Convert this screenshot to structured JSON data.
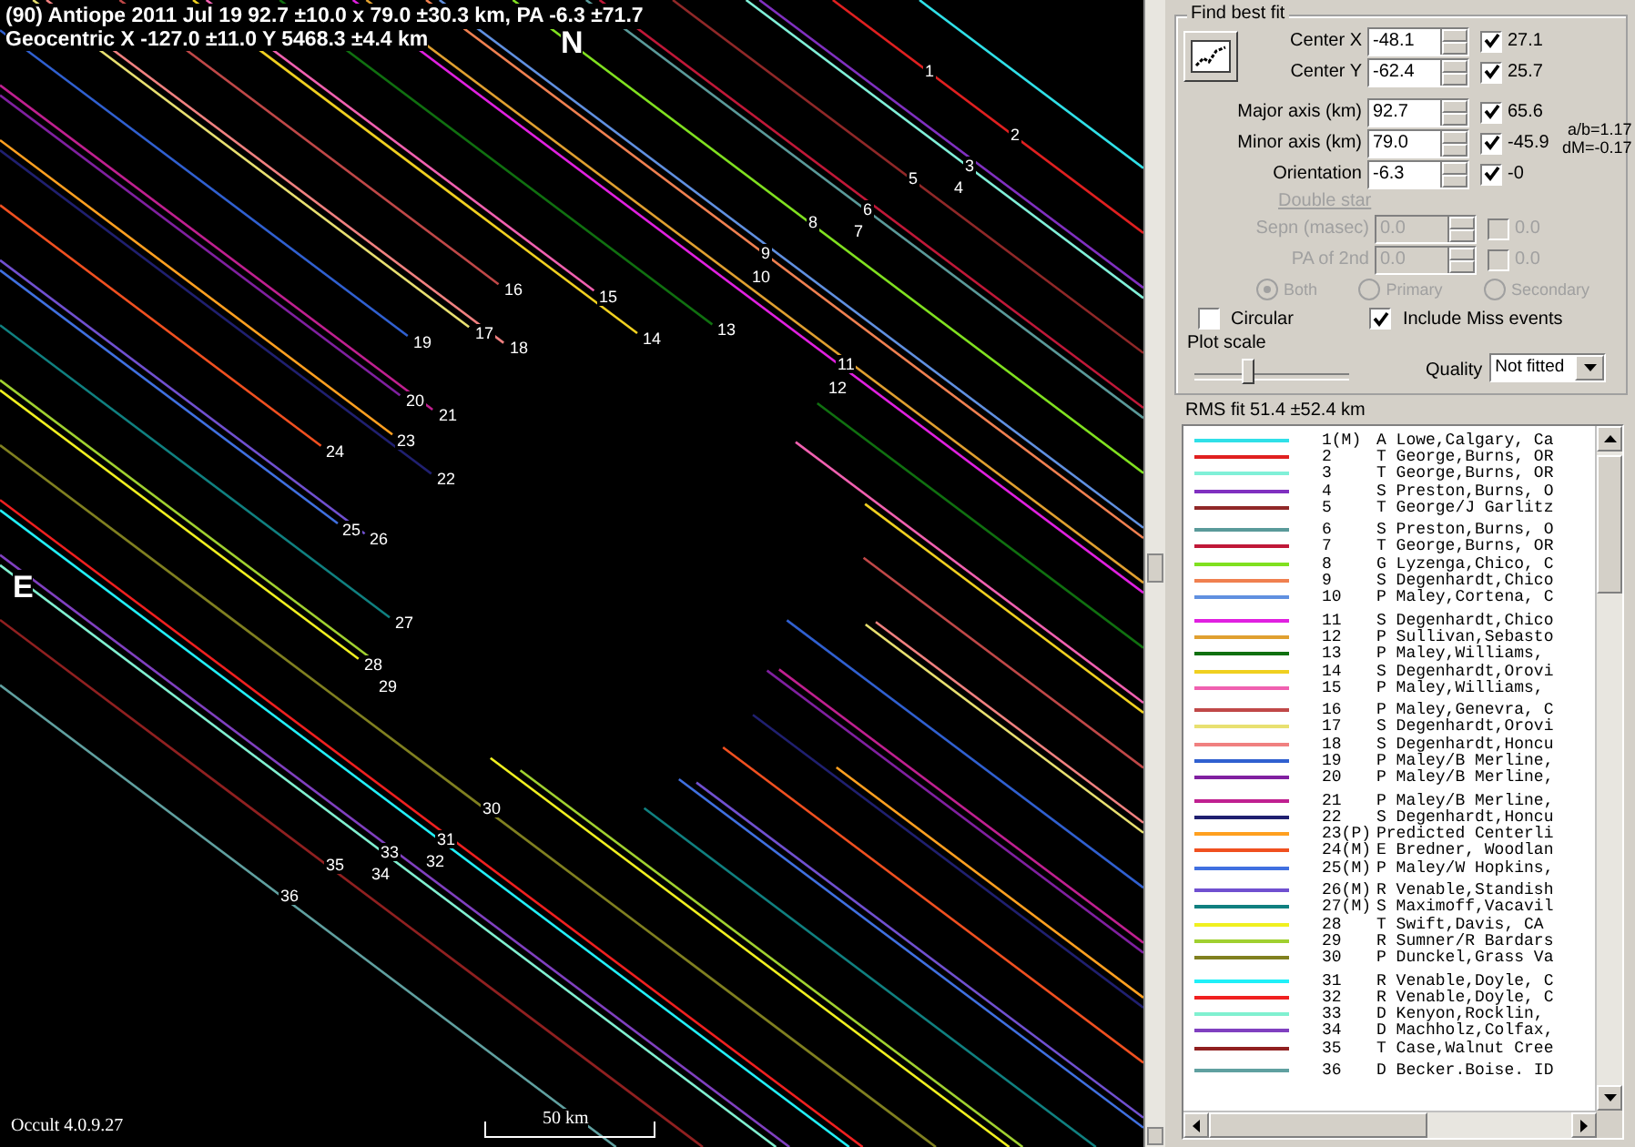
{
  "plot": {
    "title": "(90) Antiope  2011 Jul 19  92.7 ±10.0 x 79.0 ±30.3 km, PA -6.3 ±71.7",
    "subtitle": "Geocentric  X  -127.0 ±11.0  Y 5468.3 ±4.4 km",
    "north": "N",
    "east": "E",
    "scale": "50 km",
    "version": "Occult 4.0.9.27",
    "chord_labels": [
      "1",
      "2",
      "3",
      "4",
      "5",
      "6",
      "7",
      "8",
      "9",
      "10",
      "11",
      "12",
      "13",
      "14",
      "15",
      "16",
      "17",
      "18",
      "19",
      "20",
      "21",
      "22",
      "23",
      "24",
      "25",
      "26",
      "27",
      "28",
      "29",
      "30",
      "31",
      "32",
      "33",
      "34",
      "35",
      "36"
    ]
  },
  "fit": {
    "title": "Find best fit",
    "params": [
      {
        "label": "Center X",
        "value": "-48.1",
        "checked": true,
        "result": "27.1",
        "disabled": false
      },
      {
        "label": "Center Y",
        "value": "-62.4",
        "checked": true,
        "result": "25.7",
        "disabled": false
      },
      {
        "label": "Major axis (km)",
        "value": "92.7",
        "checked": true,
        "result": "65.6",
        "disabled": false
      },
      {
        "label": "Minor axis (km)",
        "value": "79.0",
        "checked": true,
        "result": "-45.9",
        "disabled": false
      },
      {
        "label": "Orientation",
        "value": "-6.3",
        "checked": true,
        "result": "-0",
        "disabled": false
      }
    ],
    "ratio": "a/b=1.17",
    "dm": "dM=-0.17",
    "double_star": {
      "title": "Double star",
      "disabled": true,
      "params": [
        {
          "label": "Sepn (masec)",
          "value": "0.0",
          "checked": false,
          "result": "0.0",
          "disabled": true
        },
        {
          "label": "PA of 2nd",
          "value": "0.0",
          "checked": false,
          "result": "0.0",
          "disabled": true
        }
      ],
      "options": [
        {
          "label": "Both",
          "selected": true
        },
        {
          "label": "Primary",
          "selected": false
        },
        {
          "label": "Secondary",
          "selected": false
        }
      ]
    },
    "circular": {
      "label": "Circular",
      "checked": false
    },
    "include_miss": {
      "label": "Include Miss events",
      "checked": true
    },
    "plot_scale": {
      "label": "Plot scale",
      "level": 0.35
    },
    "quality": {
      "label": "Quality",
      "value": "Not fitted"
    },
    "rms": "RMS fit 51.4 ±52.4 km"
  },
  "chords": [
    {
      "number": "1(M)",
      "observer": "A Lowe,Calgary, Ca",
      "color": "#30e0e8"
    },
    {
      "number": "2",
      "observer": "T George,Burns, OR",
      "color": "#e02020"
    },
    {
      "number": "3",
      "observer": "T George,Burns, OR",
      "color": "#80f0d8"
    },
    {
      "number": "4",
      "observer": "S Preston,Burns, O",
      "color": "#8030c0"
    },
    {
      "number": "5",
      "observer": "T George/J Garlitz",
      "color": "#902828"
    },
    {
      "number": "6",
      "observer": "S Preston,Burns, O",
      "color": "#5a9a9a"
    },
    {
      "number": "7",
      "observer": "T George,Burns, OR",
      "color": "#c01838"
    },
    {
      "number": "8",
      "observer": "G Lyzenga,Chico, C",
      "color": "#80e020"
    },
    {
      "number": "9",
      "observer": "S Degenhardt,Chico",
      "color": "#f08050"
    },
    {
      "number": "10",
      "observer": "P Maley,Cortena, C",
      "color": "#6090e0"
    },
    {
      "number": "11",
      "observer": "S Degenhardt,Chico",
      "color": "#e020e0"
    },
    {
      "number": "12",
      "observer": "P Sullivan,Sebasto",
      "color": "#e0a030"
    },
    {
      "number": "13",
      "observer": "P Maley,Williams,",
      "color": "#107010"
    },
    {
      "number": "14",
      "observer": "S Degenhardt,Orovi",
      "color": "#f0d020"
    },
    {
      "number": "15",
      "observer": "P Maley,Williams,",
      "color": "#f060b0"
    },
    {
      "number": "16",
      "observer": "P Maley,Genevra, C",
      "color": "#c04848"
    },
    {
      "number": "17",
      "observer": "S Degenhardt,Orovi",
      "color": "#e8e070"
    },
    {
      "number": "18",
      "observer": "S Degenhardt,Honcu",
      "color": "#f08080"
    },
    {
      "number": "19",
      "observer": "P Maley/B Merline,",
      "color": "#3060d0"
    },
    {
      "number": "20",
      "observer": "P Maley/B Merline,",
      "color": "#8020a0"
    },
    {
      "number": "21",
      "observer": "P Maley/B Merline,",
      "color": "#c02090"
    },
    {
      "number": "22",
      "observer": "S Degenhardt,Honcu",
      "color": "#202070"
    },
    {
      "number": "23(P)",
      "observer": "Predicted Centerli",
      "color": "#ffa020"
    },
    {
      "number": "24(M)",
      "observer": "E Bredner, Woodlan",
      "color": "#f05020"
    },
    {
      "number": "25(M)",
      "observer": "P Maley/W Hopkins,",
      "color": "#4070e0"
    },
    {
      "number": "26(M)",
      "observer": "R Venable,Standish",
      "color": "#7050d0"
    },
    {
      "number": "27(M)",
      "observer": "S Maximoff,Vacavil",
      "color": "#108080"
    },
    {
      "number": "28",
      "observer": "T Swift,Davis, CA",
      "color": "#f0f020"
    },
    {
      "number": "29",
      "observer": "R Sumner/R Bardars",
      "color": "#a0d030"
    },
    {
      "number": "30",
      "observer": "P Dunckel,Grass Va",
      "color": "#808020"
    },
    {
      "number": "31",
      "observer": "R Venable,Doyle, C",
      "color": "#20f0f8"
    },
    {
      "number": "32",
      "observer": "R Venable,Doyle, C",
      "color": "#f02020"
    },
    {
      "number": "33",
      "observer": "D Kenyon,Rocklin,",
      "color": "#80f0d0"
    },
    {
      "number": "34",
      "observer": "D Machholz,Colfax,",
      "color": "#8040c0"
    },
    {
      "number": "35",
      "observer": "T Case,Walnut Cree",
      "color": "#902020"
    },
    {
      "number": "36",
      "observer": "D Becker.Boise. ID",
      "color": "#60a0a0"
    }
  ]
}
